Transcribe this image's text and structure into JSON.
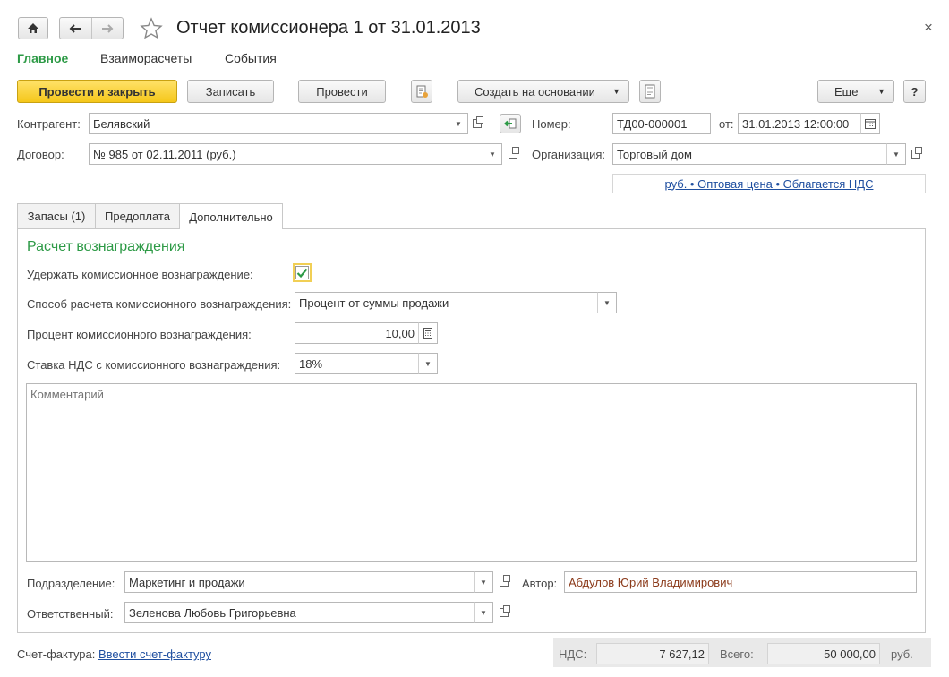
{
  "window": {
    "title": "Отчет комиссионера 1 от 31.01.2013",
    "close_glyph": "×"
  },
  "nav": {
    "main": "Главное",
    "settlements": "Взаиморасчеты",
    "events": "События"
  },
  "toolbar": {
    "post_close": "Провести и закрыть",
    "save": "Записать",
    "post": "Провести",
    "create_based": "Создать на основании",
    "more": "Еще",
    "help": "?"
  },
  "header": {
    "counterparty_label": "Контрагент:",
    "counterparty_value": "Белявский",
    "contract_label": "Договор:",
    "contract_value": "№ 985 от 02.11.2011 (руб.)",
    "number_label": "Номер:",
    "number_value": "ТД00-000001",
    "date_label": "от:",
    "date_value": "31.01.2013 12:00:00",
    "org_label": "Организация:",
    "org_value": "Торговый дом",
    "price_link": "руб. • Оптовая цена • Облагается НДС"
  },
  "tabs": [
    {
      "label": "Запасы (1)"
    },
    {
      "label": "Предоплата"
    },
    {
      "label": "Дополнительно"
    }
  ],
  "commission": {
    "section_title": "Расчет вознаграждения",
    "withhold_label": "Удержать комиссионное вознаграждение:",
    "withhold_checked": true,
    "method_label": "Способ расчета комиссионного вознаграждения:",
    "method_value": "Процент от суммы продажи",
    "percent_label": "Процент комиссионного вознаграждения:",
    "percent_value": "10,00",
    "vat_label": "Ставка НДС с комиссионного вознаграждения:",
    "vat_value": "18%",
    "comment_placeholder": "Комментарий"
  },
  "bottom": {
    "department_label": "Подразделение:",
    "department_value": "Маркетинг и продажи",
    "author_label": "Автор:",
    "author_value": "Абдулов Юрий Владимирович",
    "responsible_label": "Ответственный:",
    "responsible_value": "Зеленова Любовь Григорьевна"
  },
  "footer": {
    "invoice_label": "Счет-фактура:",
    "invoice_link": "Ввести счет-фактуру",
    "vat_label": "НДС:",
    "vat_value": "7 627,12",
    "total_label": "Всего:",
    "total_value": "50 000,00",
    "currency": "руб."
  },
  "colors": {
    "accent_green": "#2d9a46",
    "link_blue": "#1f4fa0",
    "author_text": "#8b3a1a",
    "primary_yellow": "#f5c71a"
  }
}
